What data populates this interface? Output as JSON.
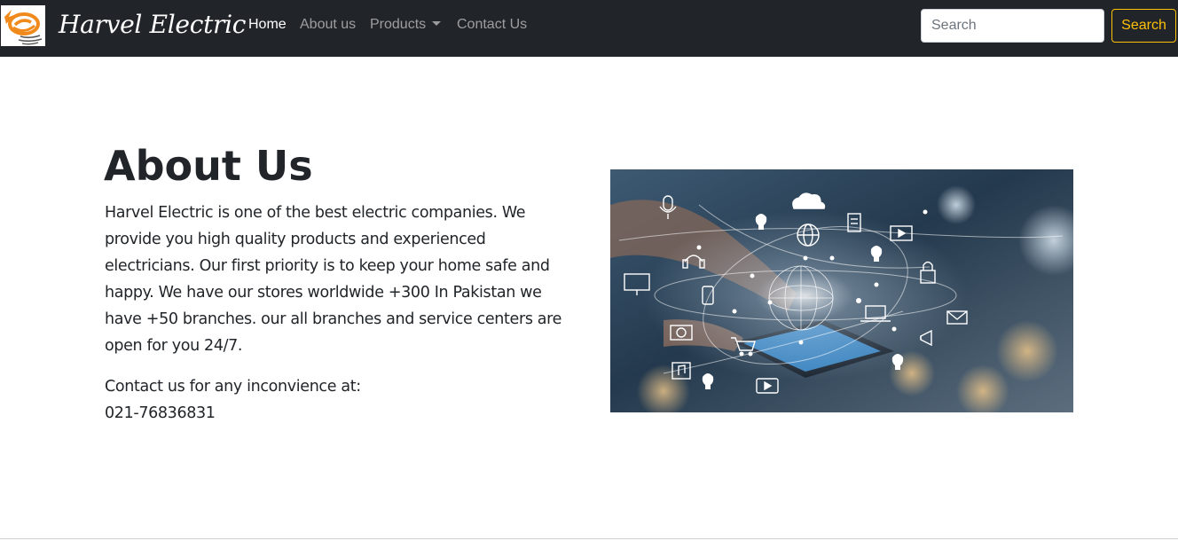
{
  "navbar": {
    "brand": "Harvel Electric",
    "links": [
      {
        "label": "Home",
        "active": true
      },
      {
        "label": "About us",
        "active": false
      },
      {
        "label": "Products",
        "active": false,
        "dropdown": true
      },
      {
        "label": "Contact Us",
        "active": false
      }
    ],
    "search": {
      "placeholder": "Search",
      "value": "",
      "button_label": "Search"
    }
  },
  "main": {
    "title": "About Us",
    "paragraph": "Harvel Electric is one of the best electric companies. We provide you high quality products and experienced electricians. Our first priority is to keep your home safe and happy. We have our stores worldwide +300 In Pakistan we have +50 branches. our all branches and service centers are open for you 24/7.",
    "contact_label": "Contact us for any inconvience at:",
    "contact_phone": "021-76836831"
  },
  "colors": {
    "navbar_bg": "#212529",
    "accent": "#ffc107",
    "text": "#212529",
    "logo_orange": "#f08a1c"
  },
  "icons": [
    "harvel-logo-icon",
    "caret-down-icon",
    "cloud-icon",
    "globe-icon",
    "lock-icon",
    "mail-icon",
    "cart-icon",
    "camera-icon",
    "music-icon",
    "play-icon",
    "monitor-icon",
    "phone-icon",
    "laptop-icon",
    "lightbulb-icon",
    "megaphone-icon",
    "document-icon",
    "microphone-icon"
  ]
}
